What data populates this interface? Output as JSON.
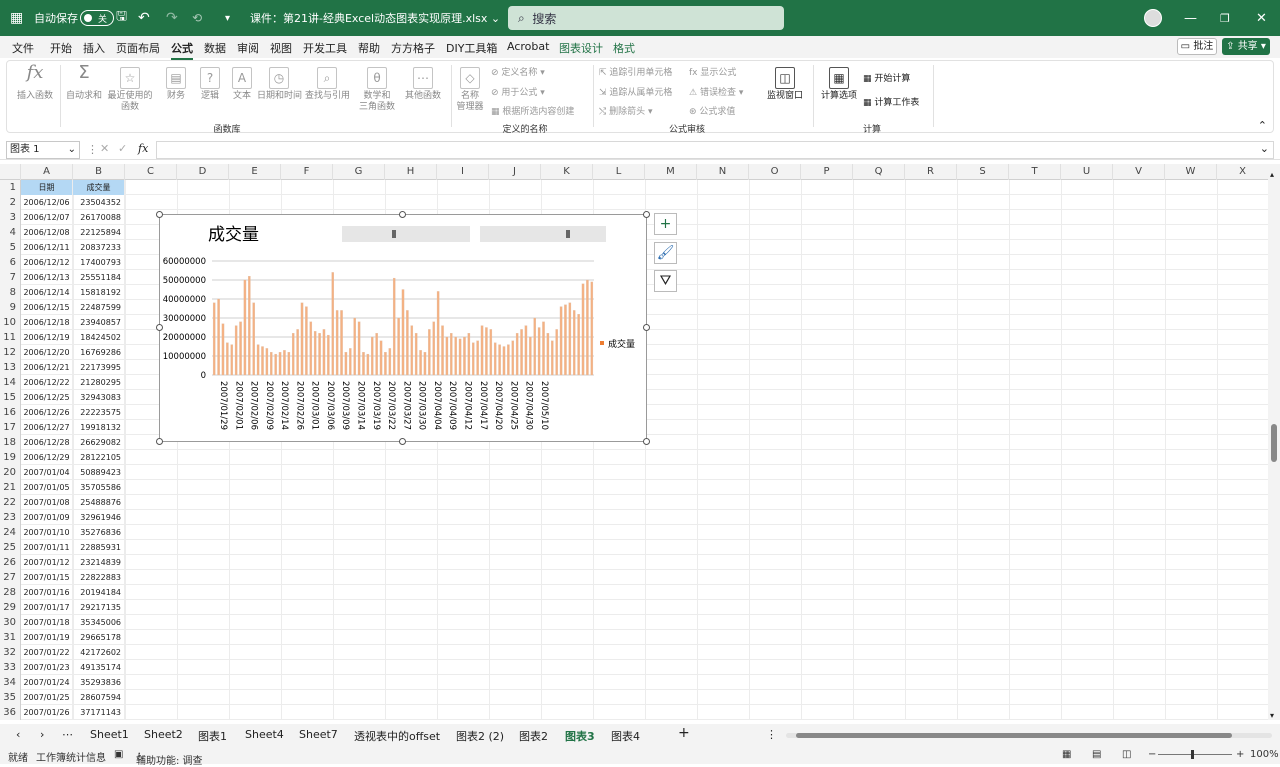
{
  "titlebar": {
    "autosave_label": "自动保存",
    "autosave_state": "关",
    "filename": "课件：第21讲-经典Excel动态图表实现原理.xlsx",
    "search_placeholder": "搜索"
  },
  "menu": [
    {
      "label": "文件"
    },
    {
      "label": "开始"
    },
    {
      "label": "插入"
    },
    {
      "label": "页面布局"
    },
    {
      "label": "公式"
    },
    {
      "label": "数据"
    },
    {
      "label": "审阅"
    },
    {
      "label": "视图"
    },
    {
      "label": "开发工具"
    },
    {
      "label": "帮助"
    },
    {
      "label": "方方格子"
    },
    {
      "label": "DIY工具箱"
    },
    {
      "label": "Acrobat"
    },
    {
      "label": "图表设计"
    },
    {
      "label": "格式"
    }
  ],
  "menu_right": {
    "comment": "批注",
    "share": "共享"
  },
  "ribbon": {
    "function_lib": {
      "insert_fn": "插入函数",
      "autosum": "自动求和",
      "recent": "最近使用的\n函数",
      "finance": "财务",
      "logic": "逻辑",
      "text": "文本",
      "datetime": "日期和时间",
      "lookup": "查找与引用",
      "math": "数学和\n三角函数",
      "other": "其他函数",
      "group": "函数库"
    },
    "names": {
      "manager": "名称\n管理器",
      "define": "定义名称",
      "use_in": "用于公式",
      "create": "根据所选内容创建",
      "group": "定义的名称"
    },
    "audit": {
      "trace_prec": "追踪引用单元格",
      "trace_dep": "追踪从属单元格",
      "remove": "删除箭头",
      "show": "显示公式",
      "check": "错误检查",
      "eval": "公式求值",
      "watch": "监视窗口",
      "group": "公式审核"
    },
    "calc": {
      "options": "计算选项",
      "calc_now": "开始计算",
      "calc_sheet": "计算工作表",
      "group": "计算"
    }
  },
  "formula_bar": {
    "name_box": "图表 1",
    "fx": "fx",
    "formula": ""
  },
  "columns": [
    "A",
    "B",
    "C",
    "D",
    "E",
    "F",
    "G",
    "H",
    "I",
    "J",
    "K",
    "L",
    "M",
    "N",
    "O",
    "P",
    "Q",
    "R",
    "S",
    "T",
    "U",
    "V",
    "W",
    "X"
  ],
  "rows": [
    {
      "n": "1",
      "a": "日期",
      "b": "成交量"
    },
    {
      "n": "2",
      "a": "2006/12/06",
      "b": "23504352"
    },
    {
      "n": "3",
      "a": "2006/12/07",
      "b": "26170088"
    },
    {
      "n": "4",
      "a": "2006/12/08",
      "b": "22125894"
    },
    {
      "n": "5",
      "a": "2006/12/11",
      "b": "20837233"
    },
    {
      "n": "6",
      "a": "2006/12/12",
      "b": "17400793"
    },
    {
      "n": "7",
      "a": "2006/12/13",
      "b": "25551184"
    },
    {
      "n": "8",
      "a": "2006/12/14",
      "b": "15818192"
    },
    {
      "n": "9",
      "a": "2006/12/15",
      "b": "22487599"
    },
    {
      "n": "10",
      "a": "2006/12/18",
      "b": "23940857"
    },
    {
      "n": "11",
      "a": "2006/12/19",
      "b": "18424502"
    },
    {
      "n": "12",
      "a": "2006/12/20",
      "b": "16769286"
    },
    {
      "n": "13",
      "a": "2006/12/21",
      "b": "22173995"
    },
    {
      "n": "14",
      "a": "2006/12/22",
      "b": "21280295"
    },
    {
      "n": "15",
      "a": "2006/12/25",
      "b": "32943083"
    },
    {
      "n": "16",
      "a": "2006/12/26",
      "b": "22223575"
    },
    {
      "n": "17",
      "a": "2006/12/27",
      "b": "19918132"
    },
    {
      "n": "18",
      "a": "2006/12/28",
      "b": "26629082"
    },
    {
      "n": "19",
      "a": "2006/12/29",
      "b": "28122105"
    },
    {
      "n": "20",
      "a": "2007/01/04",
      "b": "50889423"
    },
    {
      "n": "21",
      "a": "2007/01/05",
      "b": "35705586"
    },
    {
      "n": "22",
      "a": "2007/01/08",
      "b": "25488876"
    },
    {
      "n": "23",
      "a": "2007/01/09",
      "b": "32961946"
    },
    {
      "n": "24",
      "a": "2007/01/10",
      "b": "35276836"
    },
    {
      "n": "25",
      "a": "2007/01/11",
      "b": "22885931"
    },
    {
      "n": "26",
      "a": "2007/01/12",
      "b": "23214839"
    },
    {
      "n": "27",
      "a": "2007/01/15",
      "b": "22822883"
    },
    {
      "n": "28",
      "a": "2007/01/16",
      "b": "20194184"
    },
    {
      "n": "29",
      "a": "2007/01/17",
      "b": "29217135"
    },
    {
      "n": "30",
      "a": "2007/01/18",
      "b": "35345006"
    },
    {
      "n": "31",
      "a": "2007/01/19",
      "b": "29665178"
    },
    {
      "n": "32",
      "a": "2007/01/22",
      "b": "42172602"
    },
    {
      "n": "33",
      "a": "2007/01/23",
      "b": "49135174"
    },
    {
      "n": "34",
      "a": "2007/01/24",
      "b": "35293836"
    },
    {
      "n": "35",
      "a": "2007/01/25",
      "b": "28607594"
    },
    {
      "n": "36",
      "a": "2007/01/26",
      "b": "37171143"
    }
  ],
  "chart_data": {
    "type": "bar",
    "title": "成交量",
    "legend": "成交量",
    "legend_position": "right",
    "bar_color": "#f4b183",
    "ylim": [
      0,
      60000000
    ],
    "yticks": [
      "60000000",
      "50000000",
      "40000000",
      "30000000",
      "20000000",
      "10000000",
      "0"
    ],
    "xticks": [
      "2007/01/29",
      "2007/02/01",
      "2007/02/06",
      "2007/02/09",
      "2007/02/14",
      "2007/02/26",
      "2007/03/01",
      "2007/03/06",
      "2007/03/09",
      "2007/03/14",
      "2007/03/19",
      "2007/03/22",
      "2007/03/27",
      "2007/03/30",
      "2007/04/04",
      "2007/04/09",
      "2007/04/12",
      "2007/04/17",
      "2007/04/20",
      "2007/04/25",
      "2007/04/30",
      "2007/05/10"
    ],
    "values": [
      38000000,
      40000000,
      27000000,
      17000000,
      16000000,
      26000000,
      28000000,
      50000000,
      52000000,
      38000000,
      16000000,
      15000000,
      14000000,
      12000000,
      11000000,
      12000000,
      13000000,
      12000000,
      22000000,
      24000000,
      38000000,
      36000000,
      28000000,
      23000000,
      22000000,
      24000000,
      21000000,
      54000000,
      34000000,
      34000000,
      12000000,
      14000000,
      30000000,
      28000000,
      12000000,
      11000000,
      20000000,
      22000000,
      18000000,
      12000000,
      14000000,
      51000000,
      30000000,
      45000000,
      34000000,
      26000000,
      22000000,
      13000000,
      12000000,
      24000000,
      28000000,
      44000000,
      26000000,
      20000000,
      22000000,
      20000000,
      19000000,
      20000000,
      22000000,
      17000000,
      18000000,
      26000000,
      25000000,
      24000000,
      17000000,
      16000000,
      15000000,
      16000000,
      18000000,
      22000000,
      24000000,
      26000000,
      20000000,
      30000000,
      25000000,
      28000000,
      22000000,
      18000000,
      24000000,
      36000000,
      37000000,
      38000000,
      34000000,
      32000000,
      48000000,
      50000000,
      49000000
    ]
  },
  "sheet_tabs": [
    {
      "label": "Sheet1"
    },
    {
      "label": "Sheet2"
    },
    {
      "label": "图表1"
    },
    {
      "label": "Sheet4"
    },
    {
      "label": "Sheet7"
    },
    {
      "label": "透视表中的offset"
    },
    {
      "label": "图表2 (2)"
    },
    {
      "label": "图表2"
    },
    {
      "label": "图表3",
      "active": true
    },
    {
      "label": "图表4"
    }
  ],
  "status": {
    "ready": "就绪",
    "workbook_stats": "工作簿统计信息",
    "accessibility": "辅助功能: 调查",
    "zoom": "100%"
  }
}
